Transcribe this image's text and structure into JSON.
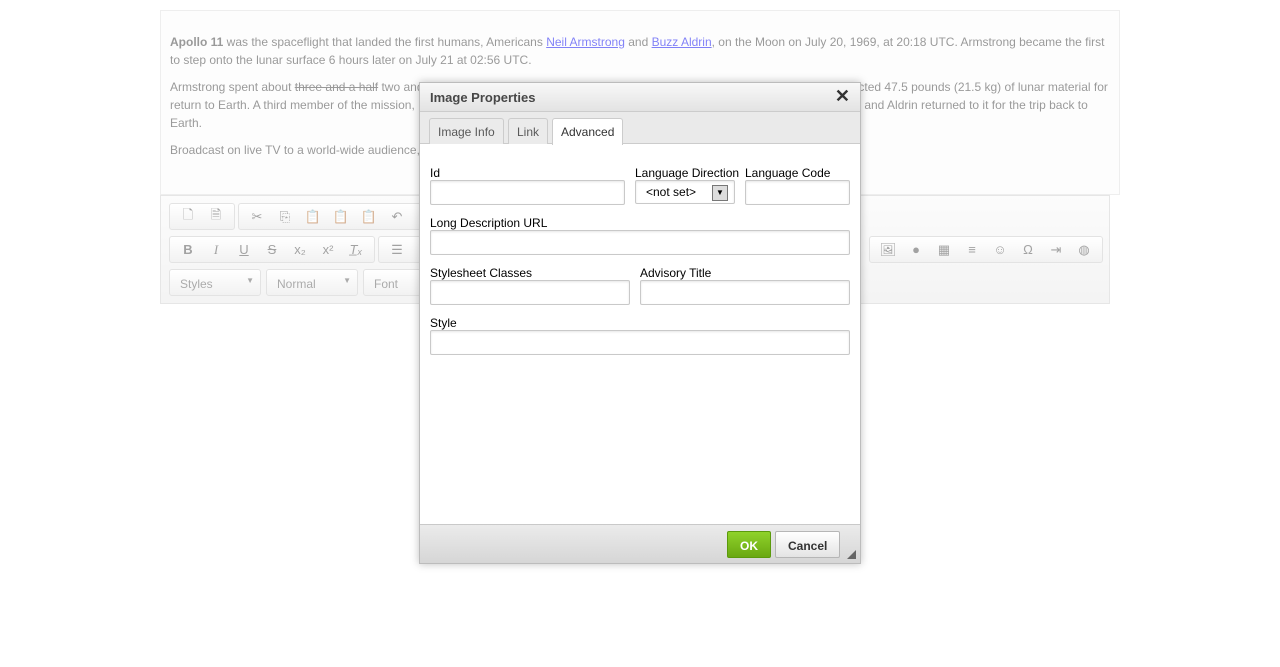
{
  "content": {
    "p1": {
      "bold": "Apollo 11",
      "t1": " was the spaceflight that landed the first humans, Americans ",
      "link1": "Neil Armstrong",
      "t2": " and ",
      "link2": "Buzz Aldrin",
      "t3": ", on the Moon on July 20, 1969, at 20:18 UTC. Armstrong became the first to step onto the lunar surface 6 hours later on July 21 at 02:56 UTC."
    },
    "p2": {
      "t1": "Armstrong spent about ",
      "strike": "three and a half",
      "t2": " two and a quarter hours outside the spacecraft, Aldrin slightly less; and together they collected 47.5 pounds (21.5 kg) of lunar material for return to Earth. A third member of the mission, Michael Collins, piloted the command spacecraft alone in lunar orbit until Armstrong and Aldrin returned to it for the trip back to Earth."
    },
    "p3": "Broadcast on live TV to a world-wide audience, Armstrong stepped onto the lunar surface..."
  },
  "toolbar": {
    "styles": "Styles",
    "format": "Normal",
    "font": "Font"
  },
  "dialog": {
    "title": "Image Properties",
    "tabs": [
      "Image Info",
      "Link",
      "Advanced"
    ],
    "fields": {
      "id": "Id",
      "lang_dir": "Language Direction",
      "lang_dir_value": "<not set>",
      "lang_code": "Language Code",
      "long_desc": "Long Description URL",
      "classes": "Stylesheet Classes",
      "advisory": "Advisory Title",
      "style": "Style"
    },
    "ok": "OK",
    "cancel": "Cancel"
  }
}
